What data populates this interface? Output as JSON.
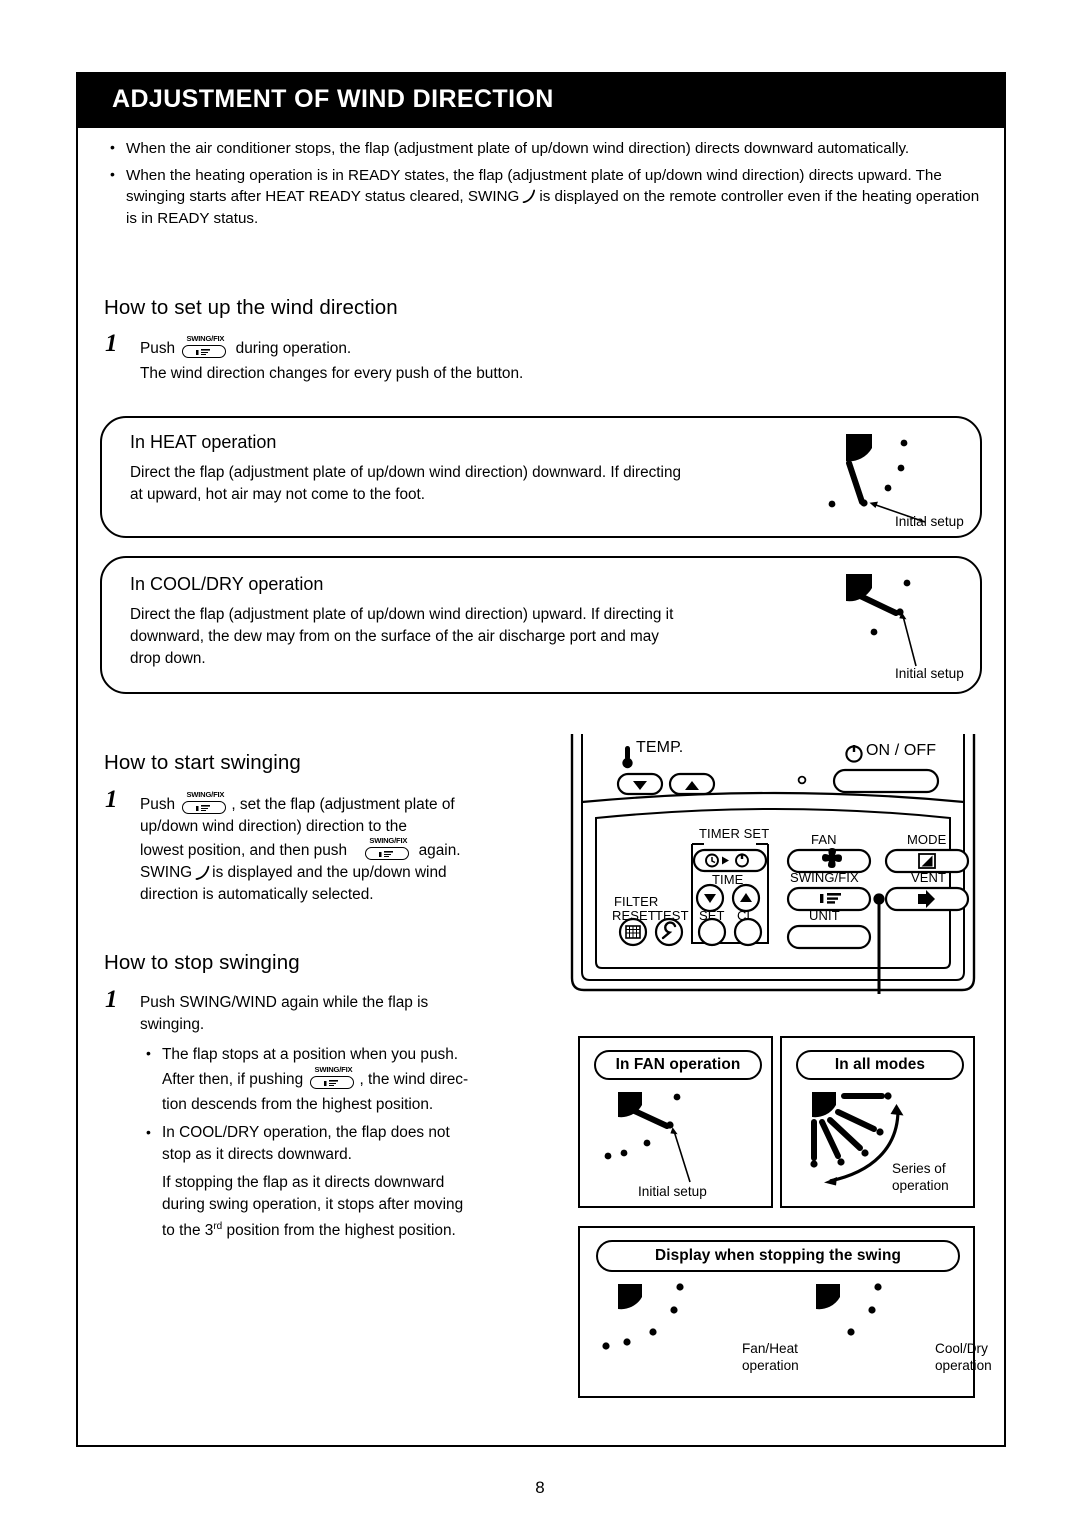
{
  "page": {
    "title": "ADJUSTMENT OF WIND DIRECTION",
    "number": "8"
  },
  "intro": {
    "bullets": [
      {
        "pre": "When the air conditioner stops, the flap (adjustment plate of up/down wind direction) directs downward automatically.",
        "post": ""
      },
      {
        "pre": "When the heating operation is in READY states, the flap (adjustment plate of up/down wind direction) directs upward. The swinging starts after HEAT READY status cleared, SWING",
        "icon": "swing-curve-icon",
        "post": "is displayed on the remote controller even if the heating operation is in READY status."
      }
    ]
  },
  "sections": {
    "setup": {
      "heading": "How to set up the wind direction",
      "step_number": "1",
      "line1_a": "Push",
      "line1_button": "SWING/FIX",
      "line1_b": "during operation.",
      "line2": "The wind direction changes for every push of the button."
    },
    "start_swing": {
      "heading": "How to start swinging",
      "step_number": "1",
      "t1": "Push",
      "btn1": "SWING/FIX",
      "t2": ", set the flap (adjustment plate of",
      "t3": "up/down wind direction) direction to the",
      "t4": "lowest position, and then push",
      "btn2": "SWING/FIX",
      "t5": "again.",
      "t6_a": "SWING",
      "t6_icon": "swing-curve-icon",
      "t6_b": "is displayed and the up/down wind",
      "t7": "direction is automatically selected."
    },
    "stop_swing": {
      "heading": "How to stop swinging",
      "step_number": "1",
      "lead1": "Push SWING/WIND again while the flap is",
      "lead2": "swinging.",
      "bullet1_l1": "The flap stops at a position when you push.",
      "bullet1_l2_a": "After then, if pushing",
      "bullet1_btn": "SWING/FIX",
      "bullet1_l2_b": ", the wind direc-",
      "bullet1_l3": "tion descends from the highest position.",
      "bullet2_l1": "In COOL/DRY operation, the flap does not",
      "bullet2_l2": "stop as it directs downward.",
      "para_l1": "If stopping the flap as it directs downward",
      "para_l2": "during swing operation, it stops after moving",
      "para_l3_a": "to the 3",
      "para_l3_sup": "rd",
      "para_l3_b": " position from the highest position."
    }
  },
  "boxes": {
    "heat": {
      "title": "In HEAT operation",
      "line1": "Direct the flap (adjustment plate of up/down wind direction) downward. If directing",
      "line2": "at upward, hot air may not come to the foot.",
      "caption": "Initial setup"
    },
    "cooldry": {
      "title": "In COOL/DRY operation",
      "line1": "Direct the flap (adjustment plate of up/down wind direction) upward. If directing it",
      "line2": "downward, the dew may from on the surface of the air discharge port and may",
      "line3": "drop down.",
      "caption": "Initial setup"
    },
    "fan": {
      "title": "In FAN operation",
      "caption": "Initial setup"
    },
    "all_modes": {
      "title": "In all modes",
      "caption_l1": "Series of",
      "caption_l2": "operation"
    },
    "display_stop": {
      "title": "Display when stopping the swing",
      "left_l1": "Fan/Heat",
      "left_l2": "operation",
      "right_l1": "Cool/Dry",
      "right_l2": "operation"
    }
  },
  "remote": {
    "temp_label": "TEMP.",
    "temp_down": "▼",
    "temp_up": "▲",
    "onoff_label": "ON / OFF",
    "timer_set": "TIMER SET",
    "time": "TIME",
    "time_down": "▼",
    "time_up": "▲",
    "set": "SET",
    "cl": "CL",
    "filter": "FILTER",
    "reset": "RESET",
    "test": "TEST",
    "fan": "FAN",
    "mode": "MODE",
    "swing_fix": "SWING/FIX",
    "vent": "VENT",
    "unit": "UNIT"
  },
  "colors": {
    "ink": "#000000",
    "paper": "#ffffff"
  }
}
